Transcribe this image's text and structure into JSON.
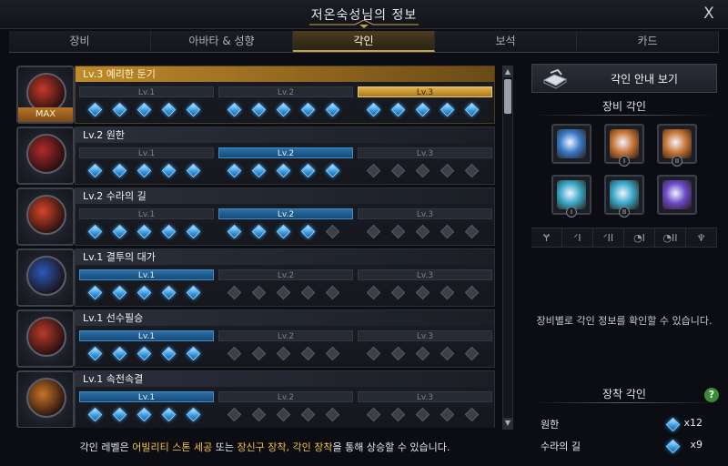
{
  "window": {
    "title": "저온숙성님의 정보",
    "close_label": "X"
  },
  "tabs": [
    {
      "label": "장비",
      "active": false
    },
    {
      "label": "아바타 & 성향",
      "active": false
    },
    {
      "label": "각인",
      "active": true
    },
    {
      "label": "보석",
      "active": false
    },
    {
      "label": "카드",
      "active": false
    }
  ],
  "engravings": [
    {
      "title": "Lv.3 예리한 둔기",
      "level": 3,
      "badge": "MAX",
      "maxed": true,
      "lit": 15,
      "color": "#c53a2a"
    },
    {
      "title": "Lv.2 원한",
      "level": 2,
      "badge": "",
      "maxed": false,
      "lit": 10,
      "color": "#b02a2a"
    },
    {
      "title": "Lv.2 수라의 길",
      "level": 2,
      "badge": "",
      "maxed": false,
      "lit": 9,
      "color": "#d4462a"
    },
    {
      "title": "Lv.1 결투의 대가",
      "level": 1,
      "badge": "",
      "maxed": false,
      "lit": 5,
      "color": "#2a5ab8"
    },
    {
      "title": "Lv.1 선수필승",
      "level": 1,
      "badge": "",
      "maxed": false,
      "lit": 5,
      "color": "#b83a2a"
    },
    {
      "title": "Lv.1 속전속결",
      "level": 1,
      "badge": "",
      "maxed": false,
      "lit": 5,
      "color": "#c8742a"
    }
  ],
  "level_labels": [
    "Lv.1",
    "Lv.2",
    "Lv.3"
  ],
  "footer": {
    "prefix": "각인 레벨은 ",
    "hl1": "어빌리티 스톤 세공",
    "mid": " 또는 ",
    "hl2": "장신구 장착, 각인 장착",
    "suffix": "을 통해 상승할 수 있습니다."
  },
  "right_panel": {
    "guide_button": "각인 안내 보기",
    "equip_title": "장비 각인",
    "equip_slots": [
      {
        "name": "necklace",
        "mark": "",
        "color": "#3a7ac8"
      },
      {
        "name": "earring-1",
        "mark": "I",
        "color": "#c8783a"
      },
      {
        "name": "earring-2",
        "mark": "II",
        "color": "#c8783a"
      },
      {
        "name": "ring-1",
        "mark": "I",
        "color": "#3aa8c8"
      },
      {
        "name": "ring-2",
        "mark": "II",
        "color": "#3aa8c8"
      },
      {
        "name": "ability-stone",
        "mark": "",
        "color": "#6a4ac8"
      }
    ],
    "filters": [
      "Ɏ",
      "ᐟI",
      "ᐟII",
      "◔I",
      "◔II",
      "♆"
    ],
    "info_text": "장비별로 각인 정보를 확인할 수 있습니다.",
    "equipped_title": "장착 각인",
    "help_label": "?",
    "equipped": [
      {
        "name": "원한",
        "count": "x12"
      },
      {
        "name": "수라의 길",
        "count": "x9"
      }
    ]
  }
}
